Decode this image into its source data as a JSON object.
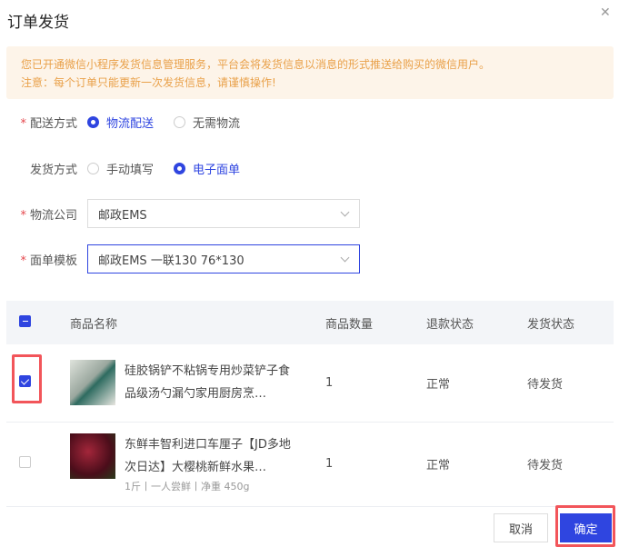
{
  "title": "订单发货",
  "notice": [
    "您已开通微信小程序发货信息管理服务，平台会将发货信息以消息的形式推送给购买的微信用户。",
    "注意：每个订单只能更新一次发货信息，请谨慎操作!"
  ],
  "form": {
    "delivery_method": {
      "label": "配送方式",
      "options": [
        "物流配送",
        "无需物流"
      ],
      "selected": 0
    },
    "ship_method": {
      "label": "发货方式",
      "options": [
        "手动填写",
        "电子面单"
      ],
      "selected": 1
    },
    "company": {
      "label": "物流公司",
      "value": "邮政EMS"
    },
    "template": {
      "label": "面单模板",
      "value": "邮政EMS 一联130 76*130"
    }
  },
  "table": {
    "headers": [
      "商品名称",
      "商品数量",
      "退款状态",
      "发货状态"
    ],
    "rows": [
      {
        "checked": true,
        "name": "硅胶锅铲不粘锅专用炒菜铲子食品级汤勺漏勺家用厨房烹…",
        "qty": "1",
        "refund": "正常",
        "ship": "待发货"
      },
      {
        "checked": false,
        "name": "东鲜丰智利进口车厘子【JD多地次日达】大樱桃新鲜水果…",
        "spec": "1斤丨一人尝鲜丨净重 450g",
        "qty": "1",
        "refund": "正常",
        "ship": "待发货"
      }
    ]
  },
  "buttons": {
    "cancel": "取消",
    "confirm": "确定"
  },
  "colors": {
    "primary": "#2f45e0",
    "warning": "#e9a14a",
    "highlight": "#f2555a"
  }
}
